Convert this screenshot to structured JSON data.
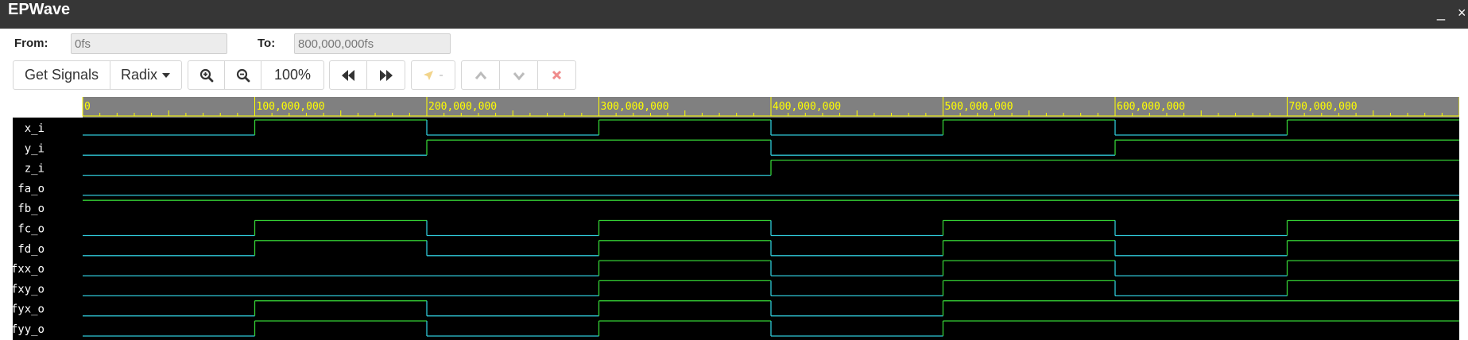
{
  "window": {
    "title": "EPWave",
    "minimize_label": "_",
    "close_label": "×"
  },
  "range": {
    "from_label": "From:",
    "from_value": "0fs",
    "to_label": "To:",
    "to_value": "800,000,000fs"
  },
  "toolbar": {
    "get_signals": "Get Signals",
    "radix": "Radix",
    "zoom_level": "100%",
    "marker_label": "-"
  },
  "colors": {
    "high": "#35d035",
    "low": "#2fc8d8",
    "ruler_bg": "#808080",
    "ruler_text": "#ffff00",
    "wave_bg": "#000000"
  },
  "chart_data": {
    "type": "waveform",
    "time_unit": "fs",
    "xlim": [
      0,
      800000000
    ],
    "ticks": [
      {
        "t": 0,
        "label": "0"
      },
      {
        "t": 100000000,
        "label": "100,000,000"
      },
      {
        "t": 200000000,
        "label": "200,000,000"
      },
      {
        "t": 300000000,
        "label": "300,000,000"
      },
      {
        "t": 400000000,
        "label": "400,000,000"
      },
      {
        "t": 500000000,
        "label": "500,000,000"
      },
      {
        "t": 600000000,
        "label": "600,000,000"
      },
      {
        "t": 700000000,
        "label": "700,000,000"
      }
    ],
    "signals": [
      {
        "name": "x_i",
        "values": [
          0,
          1,
          0,
          1,
          0,
          1,
          0,
          1
        ]
      },
      {
        "name": "y_i",
        "values": [
          0,
          0,
          1,
          1,
          0,
          0,
          1,
          1
        ]
      },
      {
        "name": "z_i",
        "values": [
          0,
          0,
          0,
          0,
          1,
          1,
          1,
          1
        ]
      },
      {
        "name": "fa_o",
        "values": [
          0,
          0,
          0,
          0,
          0,
          0,
          0,
          0
        ]
      },
      {
        "name": "fb_o",
        "values": [
          1,
          1,
          1,
          1,
          1,
          1,
          1,
          1
        ]
      },
      {
        "name": "fc_o",
        "values": [
          0,
          1,
          0,
          1,
          0,
          1,
          0,
          1
        ]
      },
      {
        "name": "fd_o",
        "values": [
          0,
          1,
          0,
          1,
          0,
          1,
          0,
          1
        ]
      },
      {
        "name": "fxx_o",
        "values": [
          0,
          0,
          0,
          1,
          0,
          1,
          0,
          1
        ]
      },
      {
        "name": "fxy_o",
        "values": [
          0,
          0,
          0,
          1,
          0,
          1,
          0,
          1
        ]
      },
      {
        "name": "fyx_o",
        "values": [
          0,
          1,
          0,
          1,
          0,
          1,
          1,
          1
        ]
      },
      {
        "name": "fyy_o",
        "values": [
          0,
          1,
          0,
          1,
          0,
          1,
          1,
          1
        ]
      }
    ]
  }
}
